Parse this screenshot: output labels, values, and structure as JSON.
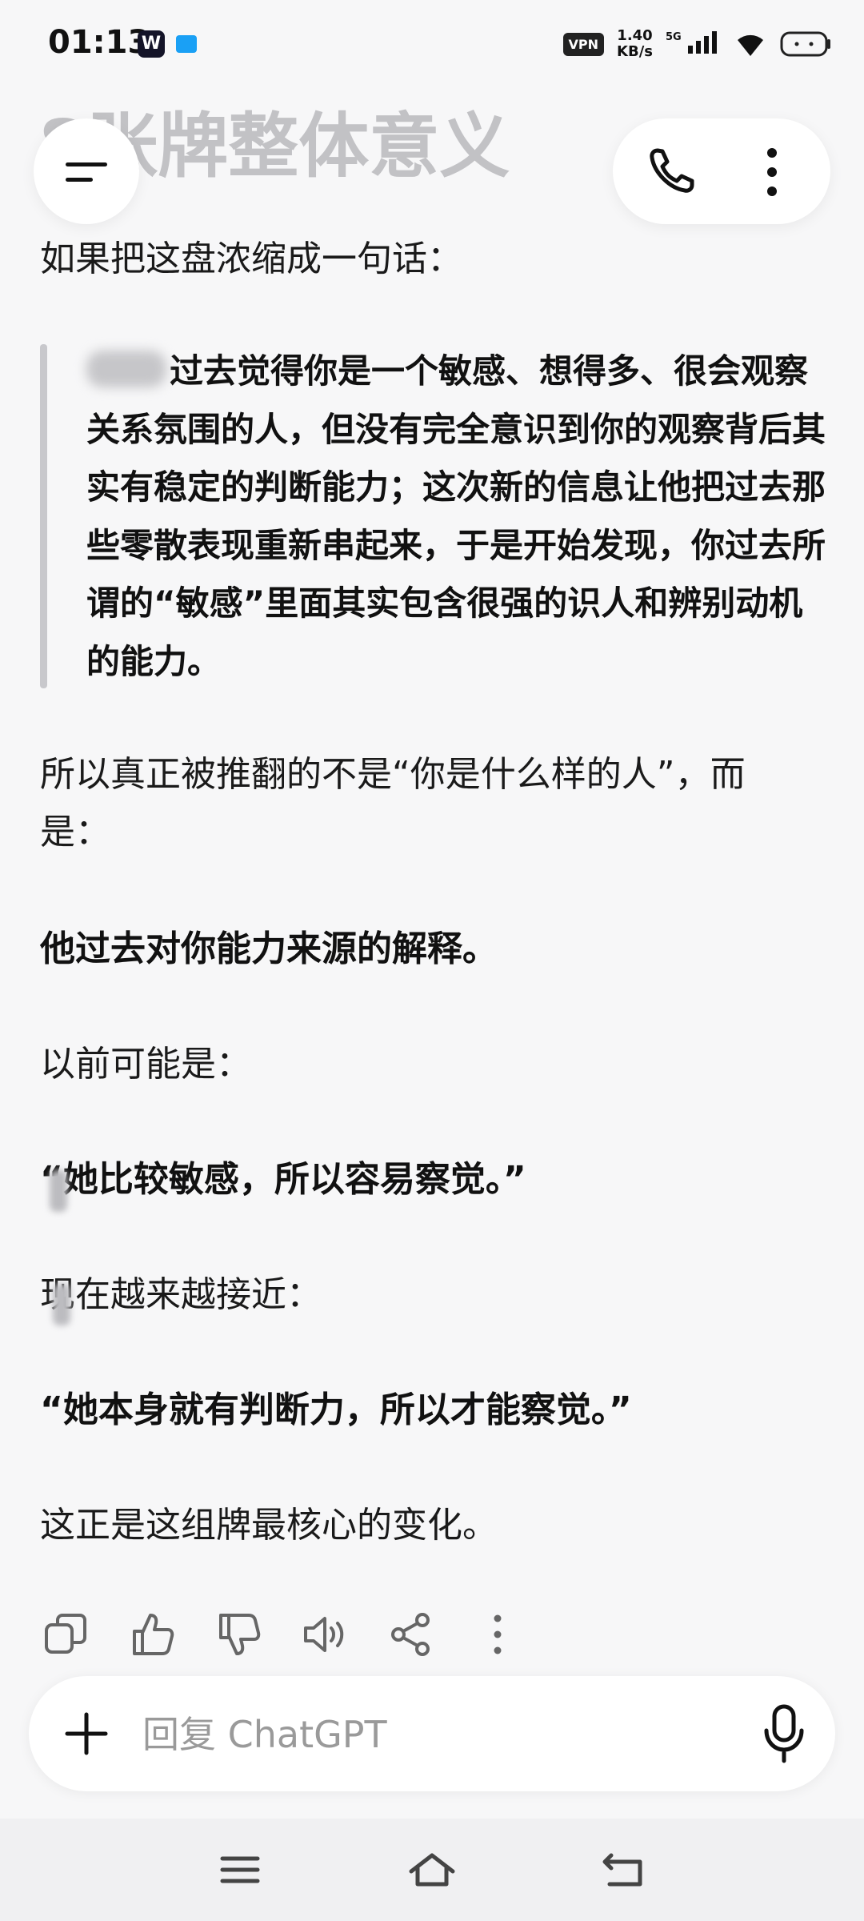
{
  "status_bar": {
    "time": "01:13",
    "app_badge_w": "W",
    "vpn": "VPN",
    "speed_value": "1.40",
    "speed_unit": "KB/s",
    "network": "5G"
  },
  "header": {
    "ghost_title": "8张牌整体意义"
  },
  "content": {
    "intro": "如果把这盘浓缩成一句话：",
    "quote_text": "过去觉得你是一个敏感、想得多、很会观察关系氛围的人，但没有完全意识到你的观察背后其实有稳定的判断能力；这次新的信息让他把过去那些零散表现重新串起来，于是开始发现，你过去所谓的“敏感”里面其实包含很强的识人和辨别动机的能力。",
    "line1a": "所以真正被推翻的不是“你是什么样的人”，而",
    "line1b": "是：",
    "bold1": "他过去对你能力来源的解释。",
    "before_label": "以前可能是：",
    "before_quote": "“她比较敏感，所以容易察觉。”",
    "now_label": "现在越来越接近：",
    "now_quote": "“她本身就有判断力，所以才能察觉。”",
    "closing": "这正是这组牌最核心的变化。"
  },
  "composer": {
    "placeholder": "回复 ChatGPT"
  },
  "icons": {
    "menu": "menu-icon",
    "phone": "phone-icon",
    "more": "more-vertical-icon",
    "copy": "copy-icon",
    "like": "thumbs-up-icon",
    "dislike": "thumbs-down-icon",
    "speaker": "read-aloud-icon",
    "share": "share-icon",
    "plus": "plus-icon",
    "mic": "microphone-icon"
  },
  "colors": {
    "background": "#f7f7f8",
    "text": "#111111",
    "quote_bar": "#c8c8cc"
  }
}
